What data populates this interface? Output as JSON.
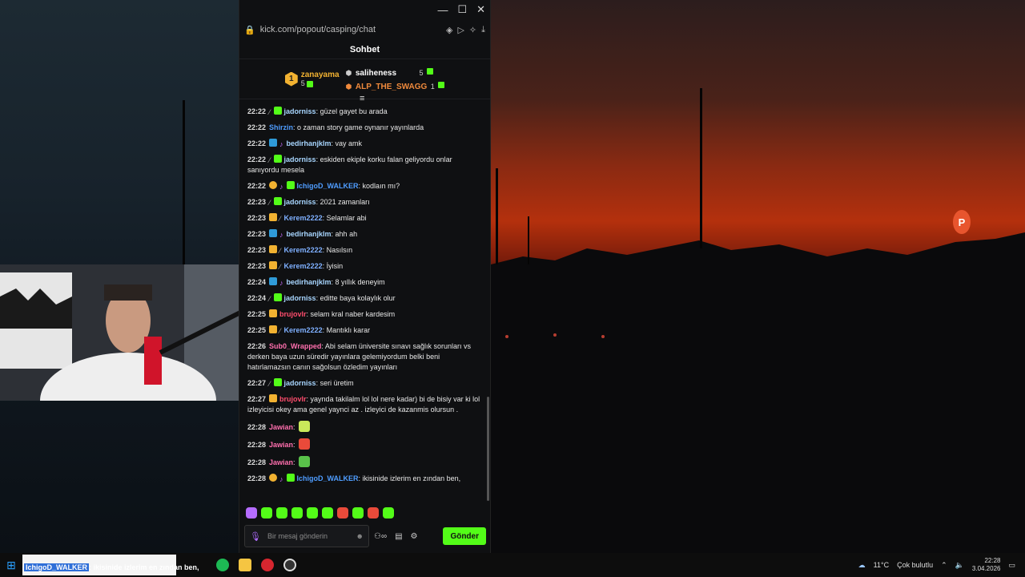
{
  "browser": {
    "url": "kick.com/popout/casping/chat",
    "window_controls": {
      "minimize": "—",
      "maximize": "☐",
      "close": "✕"
    }
  },
  "chat": {
    "title": "Sohbet",
    "leaderboard": {
      "first": {
        "rank": "1",
        "name": "zanayama",
        "count": "5"
      },
      "second": {
        "name": "saliheness",
        "count": "5"
      },
      "third": {
        "name": "ALP_THE_SWAGG",
        "count": "1"
      }
    },
    "messages": [
      {
        "time": "22:22",
        "name": "jadorniss",
        "color": "#a8d6ff",
        "badges": [
          "mod",
          "green"
        ],
        "text": ": güzel gayet bu arada"
      },
      {
        "time": "22:22",
        "name": "Shirzin",
        "color": "#4f9dff",
        "badges": [],
        "text": ": o zaman story game oynanır yayınlarda"
      },
      {
        "time": "22:22",
        "name": "bedirhanjklm",
        "color": "#a8d6ff",
        "badges": [
          "blue",
          "note"
        ],
        "text": ": vay amk"
      },
      {
        "time": "22:22",
        "name": "jadorniss",
        "color": "#a8d6ff",
        "badges": [
          "mod",
          "green"
        ],
        "text": ": eskiden ekiple korku falan geliyordu onlar sanıyordu mesela"
      },
      {
        "time": "22:22",
        "name": "IchigoD_WALKER",
        "color": "#4f9dff",
        "badges": [
          "circ",
          "note",
          "green"
        ],
        "text": ": kodlaın mı?"
      },
      {
        "time": "22:23",
        "name": "jadorniss",
        "color": "#a8d6ff",
        "badges": [
          "mod",
          "green"
        ],
        "text": ": 2021 zamanları"
      },
      {
        "time": "22:23",
        "name": "Kerem2222",
        "color": "#7fb0ff",
        "badges": [
          "crown",
          "mod"
        ],
        "text": ": Selamlar abi"
      },
      {
        "time": "22:23",
        "name": "bedirhanjklm",
        "color": "#a8d6ff",
        "badges": [
          "blue",
          "note"
        ],
        "text": ": ahh ah"
      },
      {
        "time": "22:23",
        "name": "Kerem2222",
        "color": "#7fb0ff",
        "badges": [
          "crown",
          "mod"
        ],
        "text": ": Nasılsın"
      },
      {
        "time": "22:23",
        "name": "Kerem2222",
        "color": "#7fb0ff",
        "badges": [
          "crown",
          "mod"
        ],
        "text": ": İyisin"
      },
      {
        "time": "22:24",
        "name": "bedirhanjklm",
        "color": "#a8d6ff",
        "badges": [
          "blue",
          "note"
        ],
        "text": ": 8 yıllık deneyim"
      },
      {
        "time": "22:24",
        "name": "jadorniss",
        "color": "#a8d6ff",
        "badges": [
          "mod",
          "green"
        ],
        "text": ": editte baya kolaylık olur"
      },
      {
        "time": "22:25",
        "name": "brujovlr",
        "color": "#ff4d6d",
        "badges": [
          "crown"
        ],
        "text": ": selam kral naber kardesim"
      },
      {
        "time": "22:25",
        "name": "Kerem2222",
        "color": "#7fb0ff",
        "badges": [
          "crown",
          "mod"
        ],
        "text": ": Mantıklı karar"
      },
      {
        "time": "22:26",
        "name": "Sub0_Wrapped",
        "color": "#ff6fae",
        "badges": [],
        "text": ": Abi selam üniversite sınavı sağlık sorunları vs derken baya uzun süredir yayınlara gelemiyordum belki beni hatırlamazsın canın sağolsun özledim yayınları"
      },
      {
        "time": "22:27",
        "name": "jadorniss",
        "color": "#a8d6ff",
        "badges": [
          "mod",
          "green"
        ],
        "text": ": seri üretim"
      },
      {
        "time": "22:27",
        "name": "brujovlr",
        "color": "#ff4d6d",
        "badges": [
          "crown"
        ],
        "text": ": yaynda takilalm lol lol nere kadar) bi de bisiy var ki lol izleyicisi okey ama genel yaynci az . izleyici de kazanmis olursun ."
      },
      {
        "time": "22:28",
        "name": "Jawian",
        "color": "#ff6fae",
        "badges": [],
        "text": ":",
        "emote": "#c9e85a"
      },
      {
        "time": "22:28",
        "name": "Jawian",
        "color": "#ff6fae",
        "badges": [],
        "text": ":",
        "emote": "#e94a3a"
      },
      {
        "time": "22:28",
        "name": "Jawian",
        "color": "#ff6fae",
        "badges": [],
        "text": ":",
        "emote": "#59c24a"
      },
      {
        "time": "22:28",
        "name": "IchigoD_WALKER",
        "color": "#4f9dff",
        "badges": [
          "circ",
          "note",
          "green"
        ],
        "text": ": ikisinide izlerim en zından ben,"
      }
    ],
    "emote_bar": [
      "#b56cff",
      "#53fc18",
      "#53fc18",
      "#53fc18",
      "#53fc18",
      "#53fc18",
      "#e94a3a",
      "#53fc18",
      "#e94a3a",
      "#53fc18"
    ],
    "input_placeholder": "Bir mesaj gönderin",
    "send_label": "Gönder"
  },
  "taskbar": {
    "overlay_name": "IchigoD_WALKER",
    "overlay_text": ": ikisinide izlerim en zından ben,",
    "weather": "11°C",
    "weather_desc": "Çok bulutlu",
    "time": "22:28",
    "date": "3.04.2026"
  }
}
